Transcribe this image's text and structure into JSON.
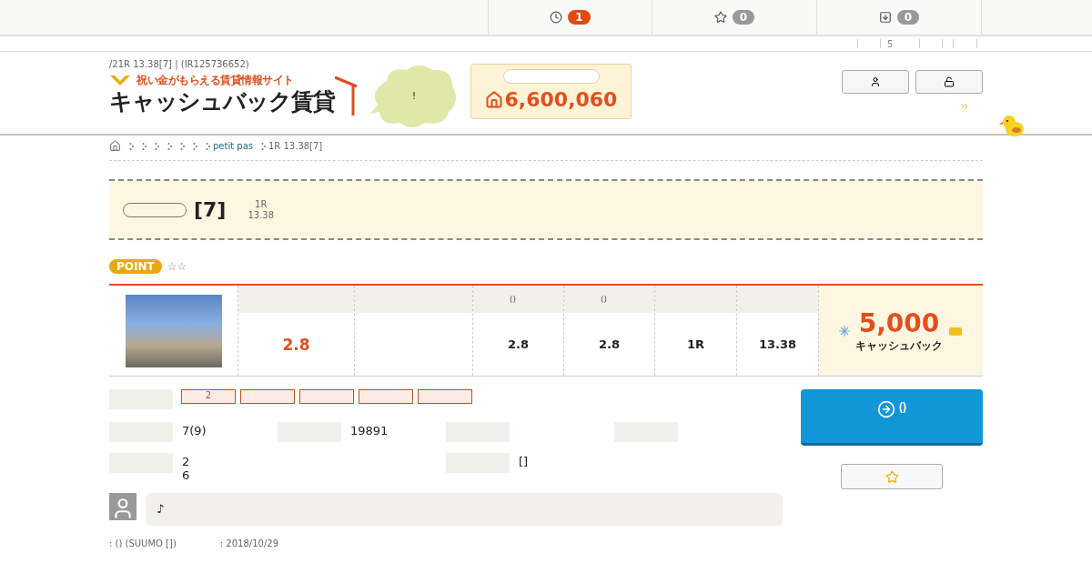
{
  "top_nav": [
    {
      "kind": "history",
      "badge": "1",
      "highlight": true
    },
    {
      "kind": "favorite",
      "badge": "0",
      "highlight": false
    },
    {
      "kind": "download",
      "badge": "0",
      "highlight": false
    }
  ],
  "sub_nav_text": "5",
  "header": {
    "meta": "/21R 13.38[7] | (IR125736652)",
    "tagline": "祝い金がもらえる賃貸情報サイト",
    "logo": "キャッシュバック賃貸",
    "cloud_text": "!",
    "counter": "6,600,060"
  },
  "breadcrumb": {
    "link": "petit pas",
    "current": "1R 13.38[7]"
  },
  "title": {
    "room": "[7]",
    "layout": "1R",
    "area": "13.38"
  },
  "point": {
    "badge": "POINT",
    "stars_text": "☆☆"
  },
  "summary": {
    "columns": [
      {
        "kind": "value",
        "value": "2.8",
        "accent": true
      },
      {
        "kind": "blank"
      },
      {
        "kind": "value",
        "header": "()",
        "value": "2.8",
        "accent": false
      },
      {
        "kind": "value",
        "header": "()",
        "value": "2.8",
        "accent": false
      },
      {
        "kind": "value",
        "value": "1R",
        "accent": false
      },
      {
        "kind": "value",
        "value": "13.38",
        "accent": false
      }
    ],
    "cashback": "5,000",
    "cashback_label": "キャッシュバック"
  },
  "tags": [
    {
      "kind": "text",
      "label": "2"
    },
    {
      "kind": "empty"
    },
    {
      "kind": "empty"
    },
    {
      "kind": "empty"
    },
    {
      "kind": "empty"
    }
  ],
  "details": [
    [
      {
        "kind": "value",
        "value": "7(9)"
      },
      {
        "kind": "value",
        "value": "19891"
      },
      {
        "kind": "label"
      },
      {
        "kind": "label"
      }
    ],
    [
      {
        "kind": "value",
        "value": "2\n6"
      },
      {
        "kind": "none"
      },
      {
        "kind": "value",
        "value": "[]"
      }
    ]
  ],
  "comment": "♪",
  "footer": {
    "source": ": ()  (SUUMO [])",
    "date": ": 2018/10/29"
  },
  "inquiry_button": "()"
}
